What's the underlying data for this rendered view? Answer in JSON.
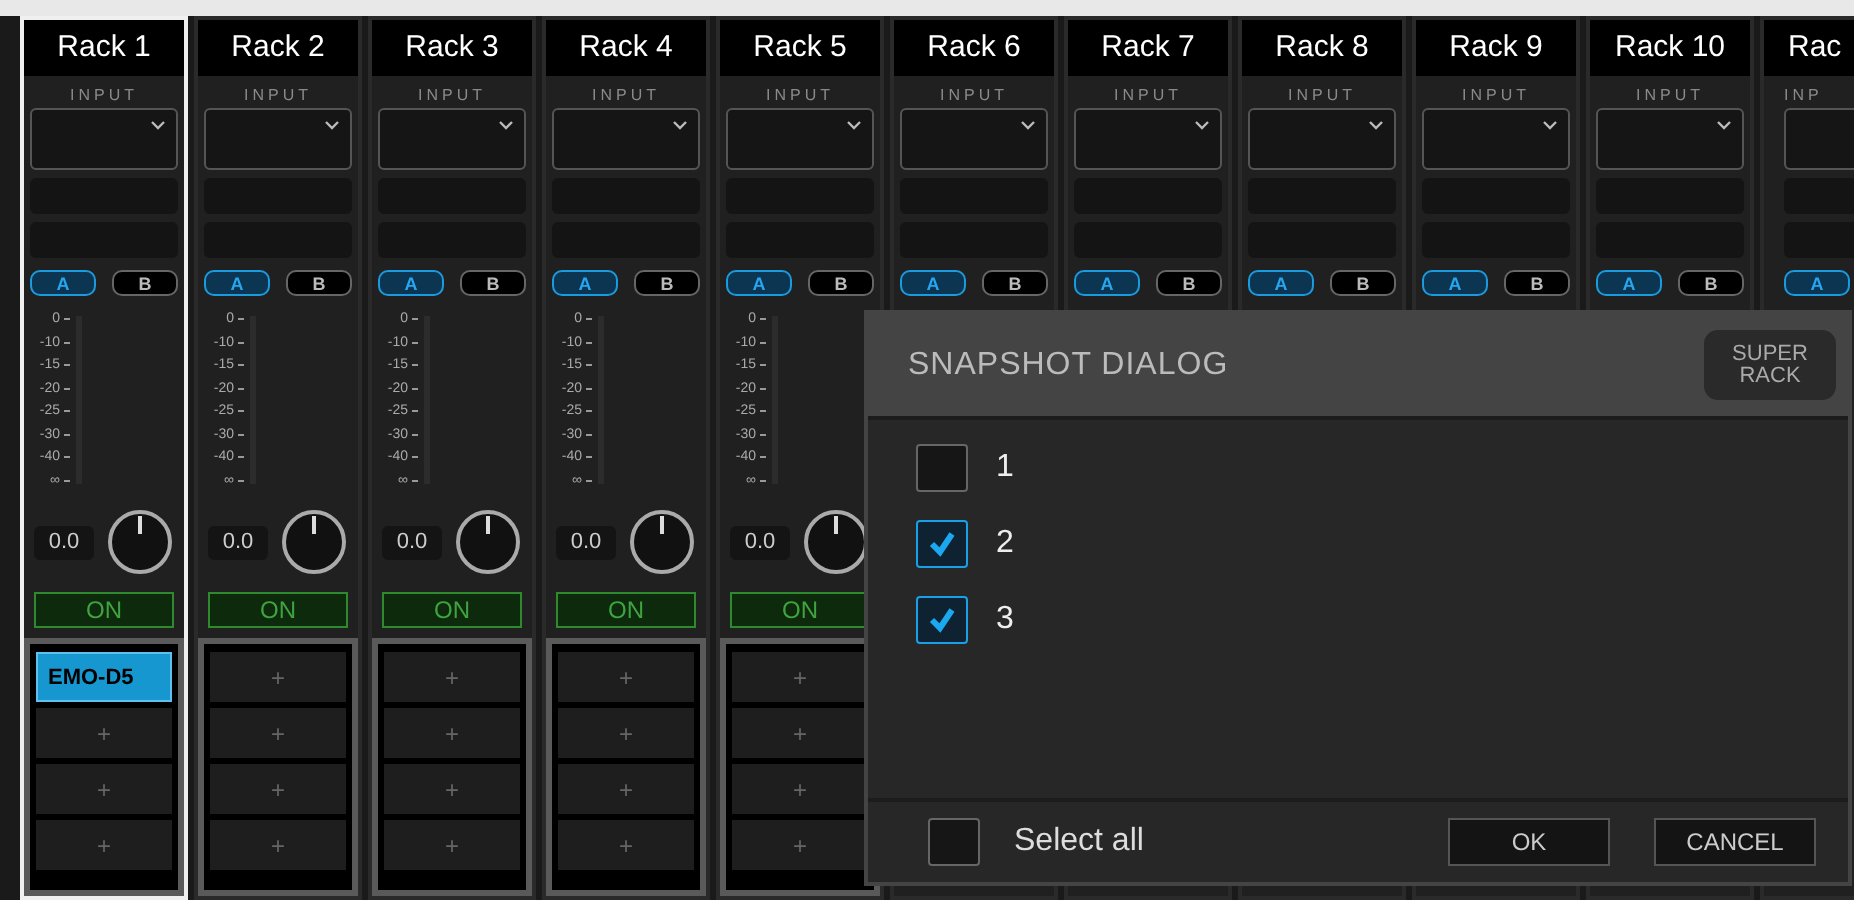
{
  "racks": [
    {
      "title": "Rack 1",
      "selected": true,
      "input_label": "INPUT",
      "ab": [
        {
          "label": "A",
          "selected": true
        },
        {
          "label": "B",
          "selected": false
        }
      ],
      "meter_scale": [
        "0",
        "-10",
        "-15",
        "-20",
        "-25",
        "-30",
        "-40",
        "∞"
      ],
      "gain": "0.0",
      "power": {
        "label": "ON",
        "on": true
      },
      "slots": [
        {
          "kind": "plugin",
          "label": "EMO-D5"
        },
        {
          "kind": "empty",
          "label": "+"
        },
        {
          "kind": "empty",
          "label": "+"
        },
        {
          "kind": "empty",
          "label": "+"
        }
      ]
    },
    {
      "title": "Rack 2",
      "selected": false,
      "input_label": "INPUT",
      "ab": [
        {
          "label": "A",
          "selected": true
        },
        {
          "label": "B",
          "selected": false
        }
      ],
      "meter_scale": [
        "0",
        "-10",
        "-15",
        "-20",
        "-25",
        "-30",
        "-40",
        "∞"
      ],
      "gain": "0.0",
      "power": {
        "label": "ON",
        "on": true
      },
      "slots": [
        {
          "kind": "empty",
          "label": "+"
        },
        {
          "kind": "empty",
          "label": "+"
        },
        {
          "kind": "empty",
          "label": "+"
        },
        {
          "kind": "empty",
          "label": "+"
        }
      ]
    },
    {
      "title": "Rack 3",
      "selected": false,
      "input_label": "INPUT",
      "ab": [
        {
          "label": "A",
          "selected": true
        },
        {
          "label": "B",
          "selected": false
        }
      ],
      "meter_scale": [
        "0",
        "-10",
        "-15",
        "-20",
        "-25",
        "-30",
        "-40",
        "∞"
      ],
      "gain": "0.0",
      "power": {
        "label": "ON",
        "on": true
      },
      "slots": [
        {
          "kind": "empty",
          "label": "+"
        },
        {
          "kind": "empty",
          "label": "+"
        },
        {
          "kind": "empty",
          "label": "+"
        },
        {
          "kind": "empty",
          "label": "+"
        }
      ]
    },
    {
      "title": "Rack 4",
      "selected": false,
      "input_label": "INPUT",
      "ab": [
        {
          "label": "A",
          "selected": true
        },
        {
          "label": "B",
          "selected": false
        }
      ],
      "meter_scale": [
        "0",
        "-10",
        "-15",
        "-20",
        "-25",
        "-30",
        "-40",
        "∞"
      ],
      "gain": "0.0",
      "power": {
        "label": "ON",
        "on": true
      },
      "slots": [
        {
          "kind": "empty",
          "label": "+"
        },
        {
          "kind": "empty",
          "label": "+"
        },
        {
          "kind": "empty",
          "label": "+"
        },
        {
          "kind": "empty",
          "label": "+"
        }
      ]
    },
    {
      "title": "Rack 5",
      "selected": false,
      "input_label": "INPUT",
      "ab": [
        {
          "label": "A",
          "selected": true
        },
        {
          "label": "B",
          "selected": false
        }
      ],
      "meter_scale": [
        "0",
        "-10",
        "-15",
        "-20",
        "-25",
        "-30",
        "-40",
        "∞"
      ],
      "gain": "0.0",
      "power": {
        "label": "ON",
        "on": true
      },
      "slots": [
        {
          "kind": "empty",
          "label": "+"
        },
        {
          "kind": "empty",
          "label": "+"
        },
        {
          "kind": "empty",
          "label": "+"
        },
        {
          "kind": "empty",
          "label": "+"
        }
      ]
    },
    {
      "title": "Rack 6",
      "selected": false,
      "input_label": "INPUT",
      "ab": [
        {
          "label": "A",
          "selected": true
        },
        {
          "label": "B",
          "selected": false
        }
      ]
    },
    {
      "title": "Rack 7",
      "selected": false,
      "input_label": "INPUT",
      "ab": [
        {
          "label": "A",
          "selected": true
        },
        {
          "label": "B",
          "selected": false
        }
      ]
    },
    {
      "title": "Rack 8",
      "selected": false,
      "input_label": "INPUT",
      "ab": [
        {
          "label": "A",
          "selected": true
        },
        {
          "label": "B",
          "selected": false
        }
      ]
    },
    {
      "title": "Rack 9",
      "selected": false,
      "input_label": "INPUT",
      "ab": [
        {
          "label": "A",
          "selected": true
        },
        {
          "label": "B",
          "selected": false
        }
      ]
    },
    {
      "title": "Rack 10",
      "selected": false,
      "input_label": "INPUT",
      "ab": [
        {
          "label": "A",
          "selected": true
        },
        {
          "label": "B",
          "selected": false
        }
      ]
    },
    {
      "title": "Rac",
      "selected": false,
      "input_label": "INP",
      "ab": [
        {
          "label": "A",
          "selected": true
        }
      ]
    }
  ],
  "dialog": {
    "title": "SNAPSHOT DIALOG",
    "super_rack_button": "SUPER\nRACK",
    "items": [
      {
        "label": "1",
        "checked": false
      },
      {
        "label": "2",
        "checked": true
      },
      {
        "label": "3",
        "checked": true
      }
    ],
    "select_all": {
      "label": "Select all",
      "checked": false
    },
    "buttons": [
      "OK",
      "CANCEL"
    ]
  }
}
